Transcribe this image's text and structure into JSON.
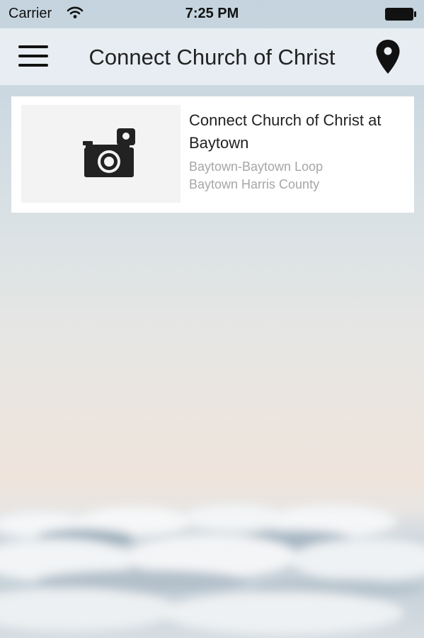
{
  "status_bar": {
    "carrier": "Carrier",
    "time": "7:25 PM",
    "wifi_icon": "wifi-icon",
    "battery_icon": "battery-icon"
  },
  "nav_bar": {
    "title": "Connect Church of Christ",
    "menu_icon": "hamburger-menu-icon",
    "location_icon": "location-pin-icon"
  },
  "churches": [
    {
      "thumbnail_icon": "camera-icon",
      "name": "Connect Church of Christ at Baytown",
      "address_line1": "Baytown-Baytown Loop",
      "address_line2": "Baytown Harris County"
    }
  ],
  "colors": {
    "card_background": "#ffffff",
    "thumbnail_background": "#f3f3f3",
    "title_text": "#222222",
    "address_text": "#a6a6a6"
  }
}
